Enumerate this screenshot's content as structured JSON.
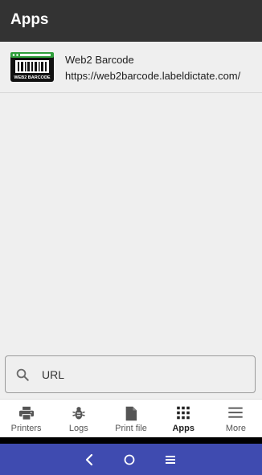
{
  "appbar": {
    "title": "Apps"
  },
  "apps": [
    {
      "name": "Web2 Barcode",
      "url": "https://web2barcode.labeldictate.com/",
      "logo_text": "WEB2 BARCODE"
    }
  ],
  "url_input": {
    "placeholder": "URL",
    "icon": "search-icon"
  },
  "bottom_nav": {
    "items": [
      {
        "label": "Printers",
        "icon": "printer-icon",
        "active": false
      },
      {
        "label": "Logs",
        "icon": "bug-icon",
        "active": false
      },
      {
        "label": "Print file",
        "icon": "file-icon",
        "active": false
      },
      {
        "label": "Apps",
        "icon": "apps-grid-icon",
        "active": true
      },
      {
        "label": "More",
        "icon": "menu-icon",
        "active": false
      }
    ]
  },
  "system_nav": {
    "buttons": [
      "back-icon",
      "home-icon",
      "recents-icon"
    ]
  },
  "colors": {
    "appbar": "#333333",
    "system_nav": "#3f4bb0",
    "background": "#efefef"
  }
}
